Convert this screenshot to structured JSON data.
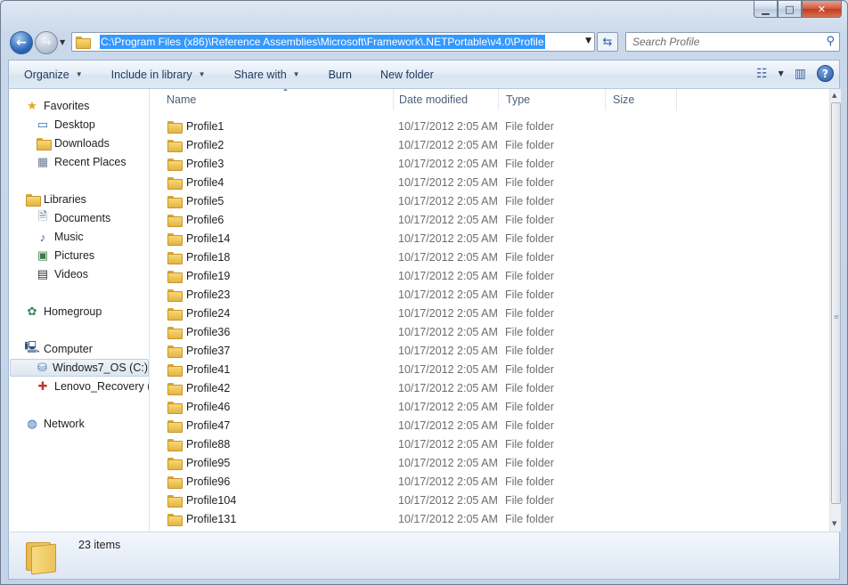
{
  "window": {
    "caption_buttons": {
      "minimize": "▁",
      "maximize": "□",
      "close": "✕"
    }
  },
  "nav": {
    "back_icon": "arrow-left-icon",
    "forward_icon": "arrow-right-icon",
    "address_path": "C:\\Program Files (x86)\\Reference Assemblies\\Microsoft\\Framework\\.NETPortable\\v4.0\\Profile",
    "search_placeholder": "Search Profile"
  },
  "toolbar": {
    "organize": "Organize",
    "include_in_library": "Include in library",
    "share_with": "Share with",
    "burn": "Burn",
    "new_folder": "New folder"
  },
  "sidebar": {
    "favorites": "Favorites",
    "desktop": "Desktop",
    "downloads": "Downloads",
    "recent_places": "Recent Places",
    "libraries": "Libraries",
    "documents": "Documents",
    "music": "Music",
    "pictures": "Pictures",
    "videos": "Videos",
    "homegroup": "Homegroup",
    "computer": "Computer",
    "windows7_os": "Windows7_OS (C:)",
    "lenovo_recovery": "Lenovo_Recovery (Q",
    "network": "Network"
  },
  "columns": {
    "name": "Name",
    "date_modified": "Date modified",
    "type": "Type",
    "size": "Size"
  },
  "files": [
    {
      "name": "Profile1",
      "date": "10/17/2012 2:05 AM",
      "type": "File folder"
    },
    {
      "name": "Profile2",
      "date": "10/17/2012 2:05 AM",
      "type": "File folder"
    },
    {
      "name": "Profile3",
      "date": "10/17/2012 2:05 AM",
      "type": "File folder"
    },
    {
      "name": "Profile4",
      "date": "10/17/2012 2:05 AM",
      "type": "File folder"
    },
    {
      "name": "Profile5",
      "date": "10/17/2012 2:05 AM",
      "type": "File folder"
    },
    {
      "name": "Profile6",
      "date": "10/17/2012 2:05 AM",
      "type": "File folder"
    },
    {
      "name": "Profile14",
      "date": "10/17/2012 2:05 AM",
      "type": "File folder"
    },
    {
      "name": "Profile18",
      "date": "10/17/2012 2:05 AM",
      "type": "File folder"
    },
    {
      "name": "Profile19",
      "date": "10/17/2012 2:05 AM",
      "type": "File folder"
    },
    {
      "name": "Profile23",
      "date": "10/17/2012 2:05 AM",
      "type": "File folder"
    },
    {
      "name": "Profile24",
      "date": "10/17/2012 2:05 AM",
      "type": "File folder"
    },
    {
      "name": "Profile36",
      "date": "10/17/2012 2:05 AM",
      "type": "File folder"
    },
    {
      "name": "Profile37",
      "date": "10/17/2012 2:05 AM",
      "type": "File folder"
    },
    {
      "name": "Profile41",
      "date": "10/17/2012 2:05 AM",
      "type": "File folder"
    },
    {
      "name": "Profile42",
      "date": "10/17/2012 2:05 AM",
      "type": "File folder"
    },
    {
      "name": "Profile46",
      "date": "10/17/2012 2:05 AM",
      "type": "File folder"
    },
    {
      "name": "Profile47",
      "date": "10/17/2012 2:05 AM",
      "type": "File folder"
    },
    {
      "name": "Profile88",
      "date": "10/17/2012 2:05 AM",
      "type": "File folder"
    },
    {
      "name": "Profile95",
      "date": "10/17/2012 2:05 AM",
      "type": "File folder"
    },
    {
      "name": "Profile96",
      "date": "10/17/2012 2:05 AM",
      "type": "File folder"
    },
    {
      "name": "Profile104",
      "date": "10/17/2012 2:05 AM",
      "type": "File folder"
    },
    {
      "name": "Profile131",
      "date": "10/17/2012 2:05 AM",
      "type": "File folder"
    }
  ],
  "status": {
    "item_count": "23 items"
  }
}
